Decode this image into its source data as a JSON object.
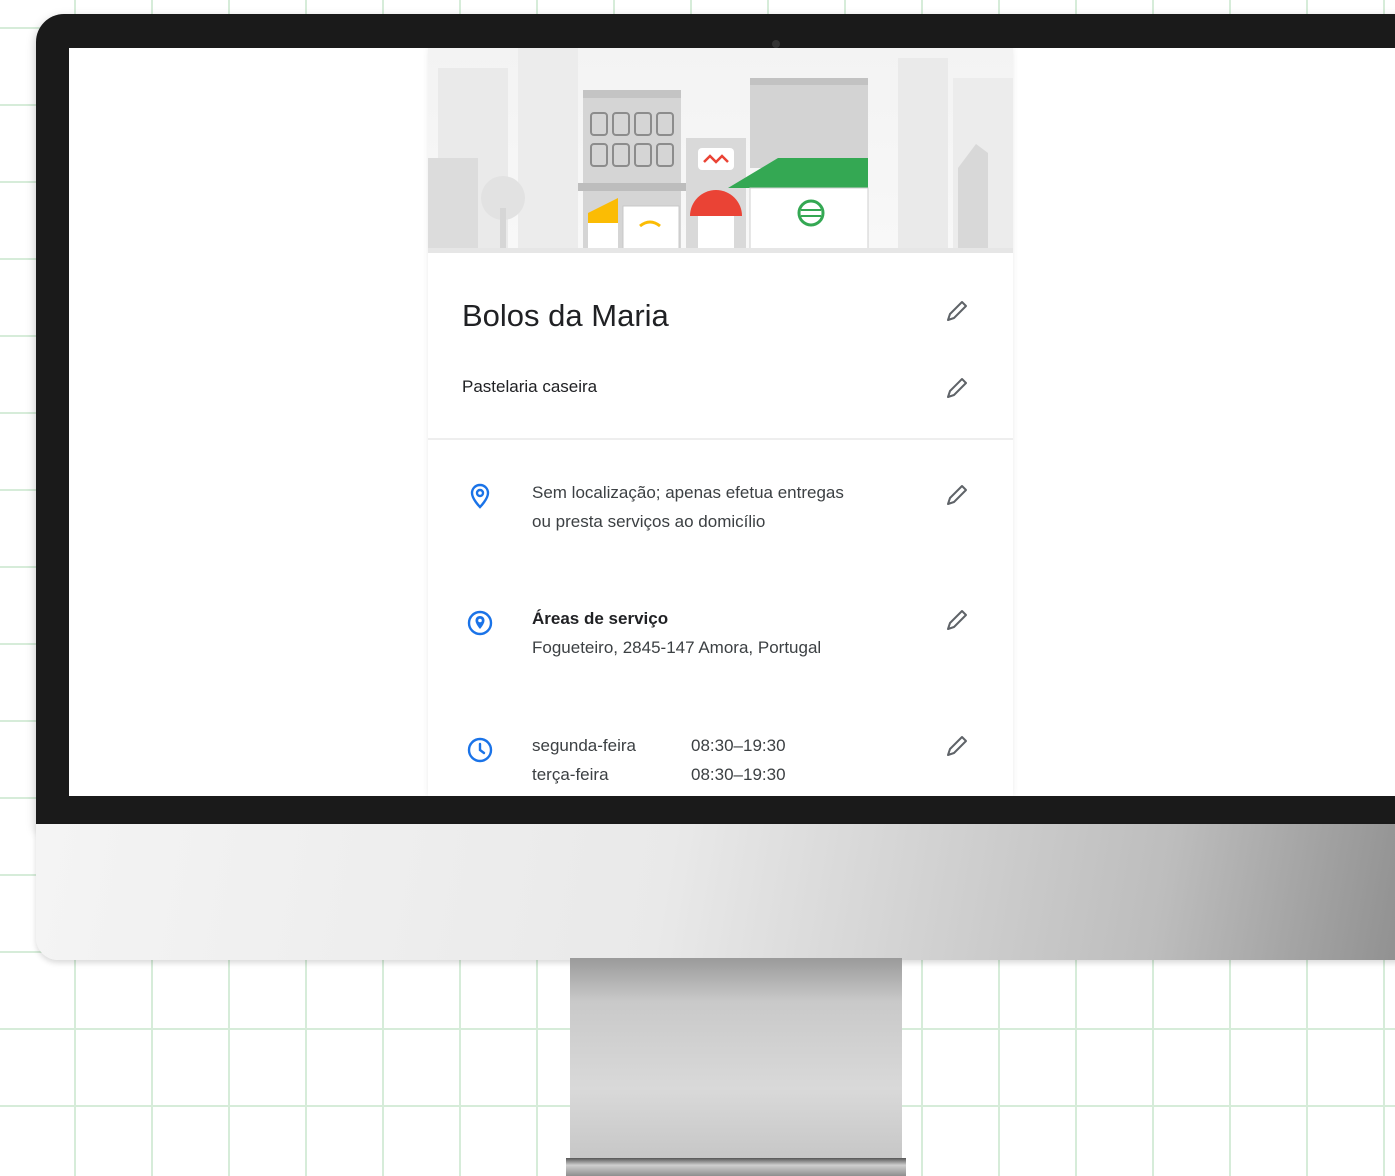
{
  "business": {
    "name": "Bolos da Maria",
    "category": "Pastelaria caseira"
  },
  "location": {
    "text_line1": "Sem localização; apenas efetua entregas",
    "text_line2": "ou presta serviços ao domicílio"
  },
  "service_area": {
    "title": "Áreas de serviço",
    "value": "Fogueteiro, 2845-147 Amora, Portugal"
  },
  "hours": [
    {
      "day": "segunda-feira",
      "time": "08:30–19:30"
    },
    {
      "day": "terça-feira",
      "time": "08:30–19:30"
    }
  ],
  "icons": {
    "edit": "pencil-icon",
    "location": "location-pin-icon",
    "service_area": "service-area-pin-icon",
    "hours": "clock-icon"
  },
  "colors": {
    "accent_blue": "#1a73e8",
    "banner_green": "#34a853",
    "banner_red": "#ea4335",
    "banner_yellow": "#fbbc04",
    "grid_green": "#d6ecd9"
  }
}
